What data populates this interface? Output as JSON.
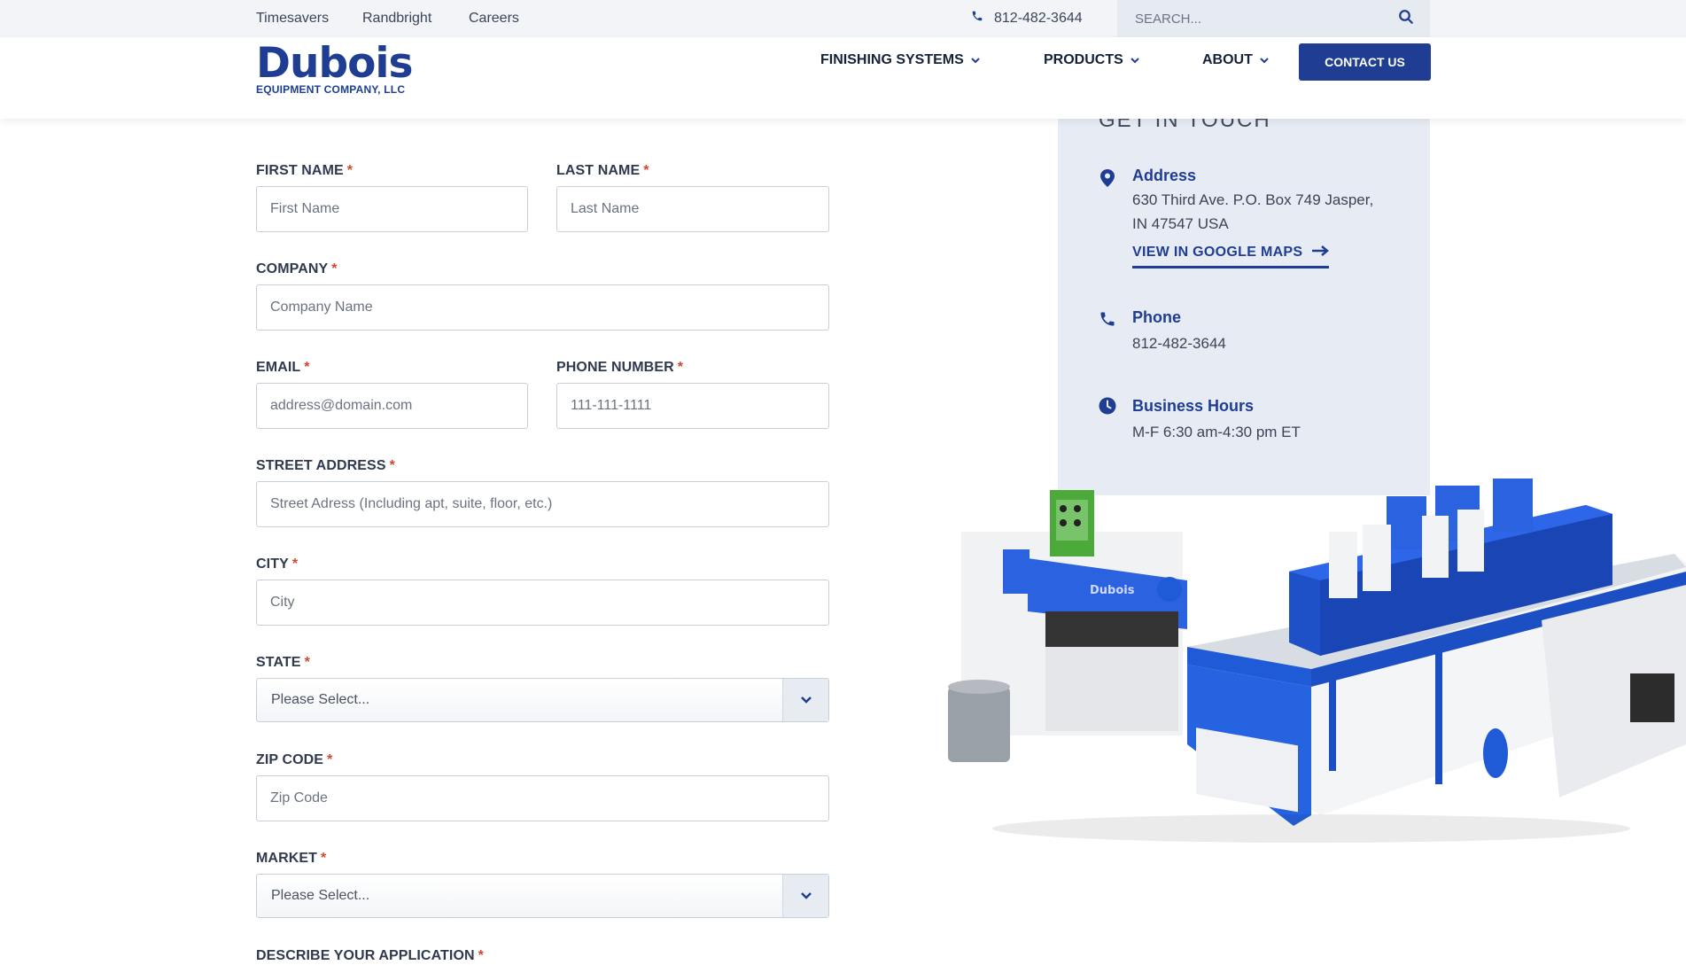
{
  "utility_bar": {
    "links": [
      "Timesavers",
      "Randbright",
      "Careers"
    ],
    "phone": "812-482-3644",
    "search_placeholder": "SEARCH..."
  },
  "header": {
    "logo_main": "Dubois",
    "logo_sub": "EQUIPMENT COMPANY, LLC",
    "nav": [
      "FINISHING SYSTEMS",
      "PRODUCTS",
      "ABOUT"
    ],
    "contact_label": "CONTACT US"
  },
  "form": {
    "first_name": {
      "label": "FIRST NAME",
      "placeholder": "First Name"
    },
    "last_name": {
      "label": "LAST NAME",
      "placeholder": "Last Name"
    },
    "company": {
      "label": "COMPANY",
      "placeholder": "Company Name"
    },
    "email": {
      "label": "EMAIL",
      "placeholder": "address@domain.com"
    },
    "phone": {
      "label": "PHONE NUMBER",
      "placeholder": "111-111-1111"
    },
    "street": {
      "label": "STREET ADDRESS",
      "placeholder": "Street Adress (Including apt, suite, floor, etc.)"
    },
    "city": {
      "label": "CITY",
      "placeholder": "City"
    },
    "state": {
      "label": "STATE",
      "value": "Please Select..."
    },
    "zip": {
      "label": "ZIP CODE",
      "placeholder": "Zip Code"
    },
    "market": {
      "label": "MARKET",
      "value": "Please Select..."
    },
    "application": {
      "label": "DESCRIBE YOUR APPLICATION"
    },
    "required_mark": "*"
  },
  "touch": {
    "title": "GET IN TOUCH",
    "address_title": "Address",
    "address_line1": "630 Third Ave. P.O. Box 749 Jasper,",
    "address_line2": "IN 47547 USA",
    "maps_link": "VIEW IN GOOGLE MAPS",
    "phone_title": "Phone",
    "phone_value": "812-482-3644",
    "hours_title": "Business Hours",
    "hours_value": "M-F 6:30 am-4:30 pm ET"
  },
  "machine": {
    "brand_label": "Dubois"
  },
  "colors": {
    "brand_blue": "#1f3e93",
    "accent_red": "#e24a32",
    "panel_bg": "#e7ebf3"
  }
}
